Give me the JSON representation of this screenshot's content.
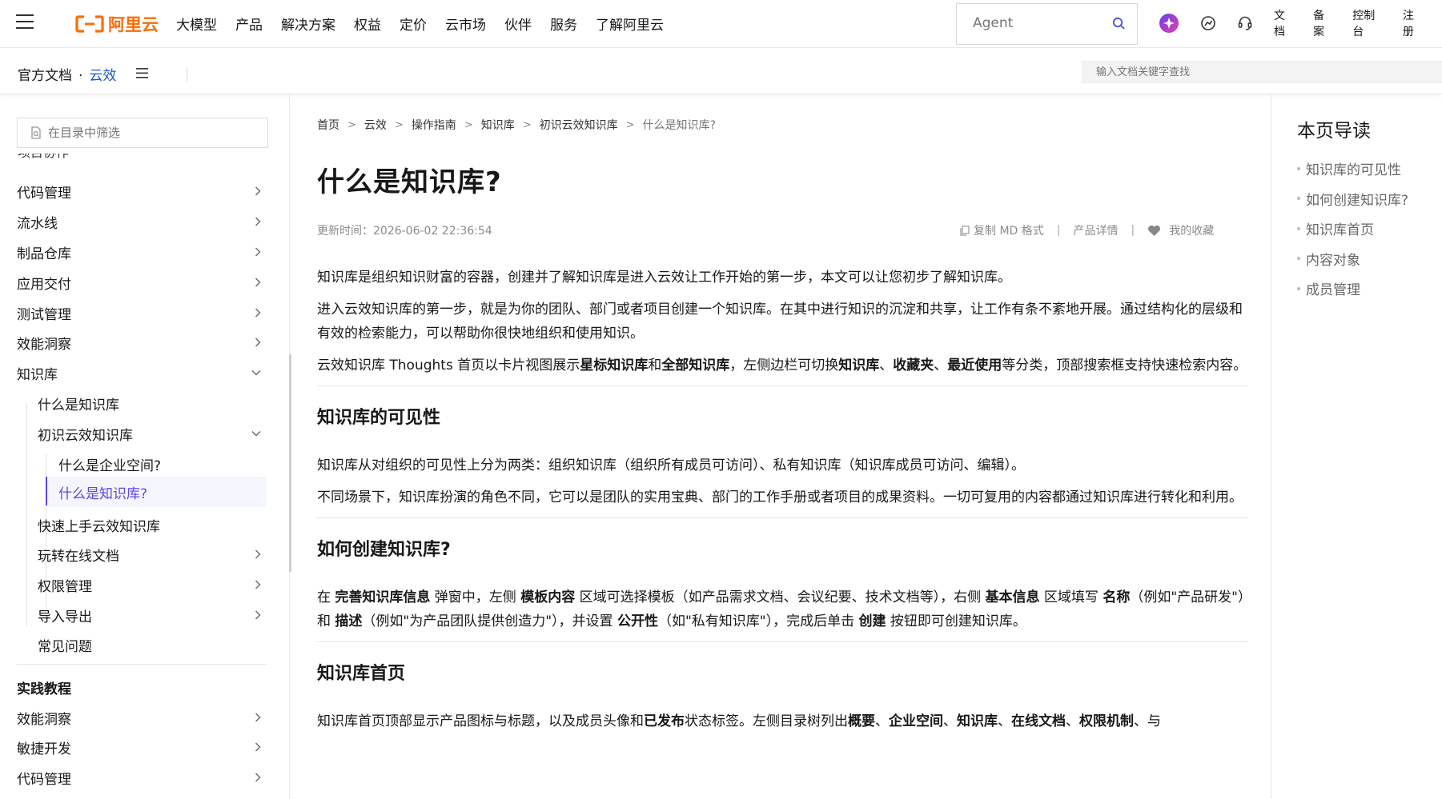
{
  "topnav": {
    "logo_text": "阿里云",
    "menu": [
      "大模型",
      "产品",
      "解决方案",
      "权益",
      "定价",
      "云市场",
      "伙伴",
      "服务",
      "了解阿里云"
    ],
    "agent_placeholder": "Agent",
    "links": [
      "文档",
      "备案",
      "控制台",
      "注册"
    ],
    "brand_color": "#ff6a00"
  },
  "subbar": {
    "docs": "官方文档",
    "dot": "·",
    "product": "云效",
    "search_placeholder": "输入文档关键字查找"
  },
  "sidebar": {
    "filter_placeholder": "在目录中筛选",
    "clipped_item": "项目协作",
    "items": [
      {
        "label": "代码管理"
      },
      {
        "label": "流水线"
      },
      {
        "label": "制品仓库"
      },
      {
        "label": "应用交付"
      },
      {
        "label": "测试管理"
      },
      {
        "label": "效能洞察"
      },
      {
        "label": "知识库"
      },
      {
        "label": "什么是知识库"
      },
      {
        "label": "初识云效知识库"
      },
      {
        "label": "什么是企业空间?"
      },
      {
        "label": "什么是知识库?"
      },
      {
        "label": "快速上手云效知识库"
      },
      {
        "label": "玩转在线文档"
      },
      {
        "label": "权限管理"
      },
      {
        "label": "导入导出"
      },
      {
        "label": "常见问题"
      },
      {
        "label": "实践教程"
      },
      {
        "label": "效能洞察"
      },
      {
        "label": "敏捷开发"
      },
      {
        "label": "代码管理"
      }
    ],
    "selected_color": "#5a45e5"
  },
  "breadcrumb": [
    "首页",
    "云效",
    "操作指南",
    "知识库",
    "初识云效知识库",
    "什么是知识库?"
  ],
  "page": {
    "title": "什么是知识库?",
    "updated": "更新时间：2026-06-02 22:36:54",
    "copy_md": "复制 MD 格式",
    "product_detail": "产品详情",
    "favorite": "我的收藏",
    "separator": "|"
  },
  "content": {
    "intro1": "知识库是组织知识财富的容器，创建并了解知识库是进入云效让工作开始的第一步，本文可以让您初步了解知识库。",
    "intro2": "进入云效知识库的第一步，就是为你的团队、部门或者项目创建一个知识库。在其中进行知识的沉淀和共享，让工作有条不紊地开展。通过结构化的层级和有效的检索能力，可以帮助你很快地组织和使用知识。",
    "intro3": [
      {
        "t": "云效知识库 Thoughts 首页以卡片视图展示"
      },
      {
        "t": "星标知识库",
        "b": true
      },
      {
        "t": "和"
      },
      {
        "t": "全部知识库",
        "b": true
      },
      {
        "t": "，左侧边栏可切换"
      },
      {
        "t": "知识库",
        "b": true
      },
      {
        "t": "、"
      },
      {
        "t": "收藏夹",
        "b": true
      },
      {
        "t": "、"
      },
      {
        "t": "最近使用",
        "b": true
      },
      {
        "t": "等分类，顶部搜索框支持快速检索内容。"
      }
    ],
    "h_visibility": "知识库的可见性",
    "vis1": "知识库从对组织的可见性上分为两类：组织知识库（组织所有成员可访问）、私有知识库（知识库成员可访问、编辑）。",
    "vis2": "不同场景下，知识库扮演的角色不同，它可以是团队的实用宝典、部门的工作手册或者项目的成果资料。一切可复用的内容都通过知识库进行转化和利用。",
    "h_create": "如何创建知识库?",
    "create1": [
      {
        "t": "在 "
      },
      {
        "t": "完善知识库信息",
        "b": true
      },
      {
        "t": " 弹窗中，左侧 "
      },
      {
        "t": "模板内容",
        "b": true
      },
      {
        "t": " 区域可选择模板（如产品需求文档、会议纪要、技术文档等），右侧 "
      },
      {
        "t": "基本信息",
        "b": true
      },
      {
        "t": " 区域填写 "
      },
      {
        "t": "名称",
        "b": true
      },
      {
        "t": "（例如\"产品研发\"）和 "
      },
      {
        "t": "描述",
        "b": true
      },
      {
        "t": "（例如\"为产品团队提供创造力\"），并设置 "
      },
      {
        "t": "公开性",
        "b": true
      },
      {
        "t": "（如\"私有知识库\"），完成后单击 "
      },
      {
        "t": "创建",
        "b": true
      },
      {
        "t": " 按钮即可创建知识库。"
      }
    ],
    "h_home": "知识库首页",
    "home1": [
      {
        "t": "知识库首页顶部显示产品图标与标题，以及成员头像和"
      },
      {
        "t": "已发布",
        "b": true
      },
      {
        "t": "状态标签。左侧目录树列出"
      },
      {
        "t": "概要",
        "b": true
      },
      {
        "t": "、"
      },
      {
        "t": "企业空间",
        "b": true
      },
      {
        "t": "、"
      },
      {
        "t": "知识库",
        "b": true
      },
      {
        "t": "、"
      },
      {
        "t": "在线文档",
        "b": true
      },
      {
        "t": "、"
      },
      {
        "t": "权限机制",
        "b": true
      },
      {
        "t": "、与"
      }
    ]
  },
  "toc": {
    "title": "本页导读",
    "items": [
      "知识库的可见性",
      "如何创建知识库?",
      "知识库首页",
      "内容对象",
      "成员管理"
    ]
  }
}
